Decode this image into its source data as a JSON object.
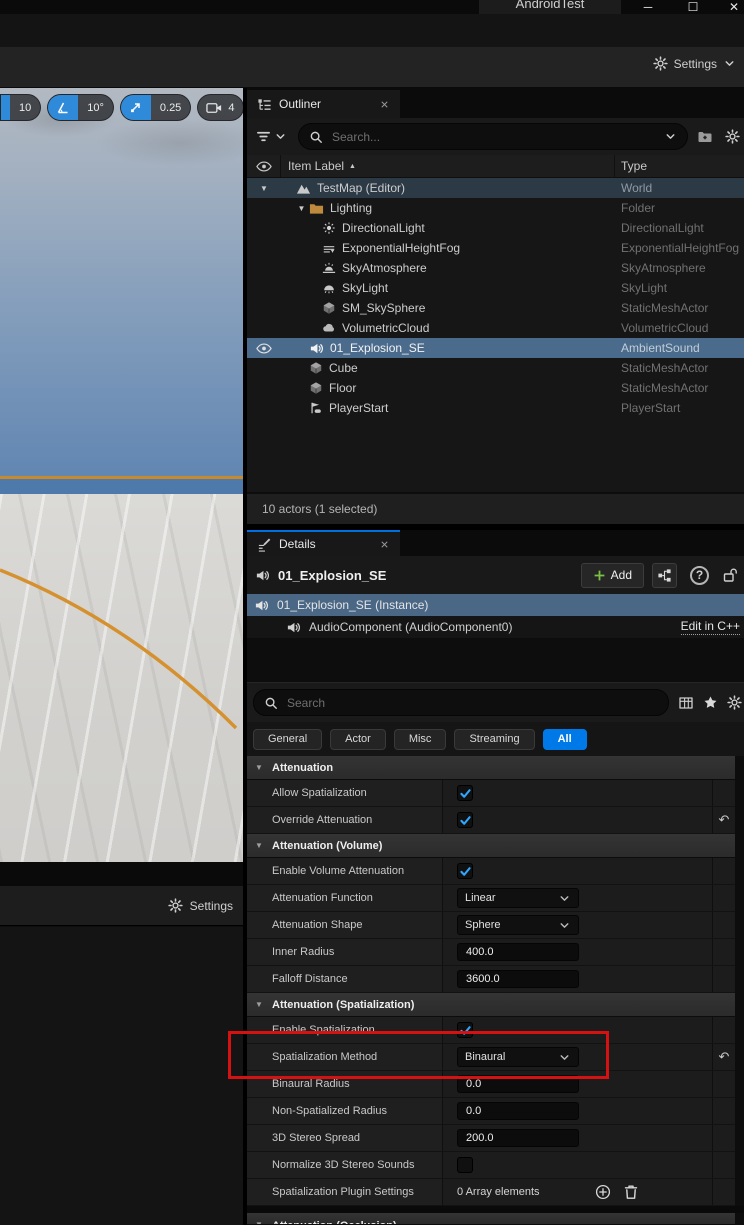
{
  "window": {
    "title": "AndroidTest",
    "controls": {
      "minimize": "─",
      "maximize": "☐",
      "close": "✕"
    }
  },
  "top_toolbar": {
    "settings_label": "Settings"
  },
  "viewport": {
    "snap_position": "10",
    "snap_rotation": "10°",
    "snap_scale": "0.25",
    "camera_speed": "4",
    "settings_label": "Settings"
  },
  "colors": {
    "selection_blue": "#4a6b8c",
    "accent_blue": "#0079e8",
    "check_blue": "#2fa7ff",
    "folder_orange": "#c08a3e",
    "horizon_orange": "#c98a2e",
    "highlight_red": "#d51111"
  },
  "outliner": {
    "tab": "Outliner",
    "search_placeholder": "Search...",
    "columns": {
      "item_label": "Item Label",
      "type": "Type"
    },
    "rows": [
      {
        "label": "TestMap (Editor)",
        "type": "World",
        "indent": 0,
        "icon": "world",
        "expander": true,
        "focus": true
      },
      {
        "label": "Lighting",
        "type": "Folder",
        "indent": 1,
        "icon": "folder",
        "expander": true
      },
      {
        "label": "DirectionalLight",
        "type": "DirectionalLight",
        "indent": 2,
        "icon": "sun"
      },
      {
        "label": "ExponentialHeightFog",
        "type": "ExponentialHeightFog",
        "indent": 2,
        "icon": "fog"
      },
      {
        "label": "SkyAtmosphere",
        "type": "SkyAtmosphere",
        "indent": 2,
        "icon": "atmosphere"
      },
      {
        "label": "SkyLight",
        "type": "SkyLight",
        "indent": 2,
        "icon": "skylight"
      },
      {
        "label": "SM_SkySphere",
        "type": "StaticMeshActor",
        "indent": 2,
        "icon": "mesh"
      },
      {
        "label": "VolumetricCloud",
        "type": "VolumetricCloud",
        "indent": 2,
        "icon": "cloud"
      },
      {
        "label": "01_Explosion_SE",
        "type": "AmbientSound",
        "indent": 1,
        "icon": "speaker",
        "selected": true
      },
      {
        "label": "Cube",
        "type": "StaticMeshActor",
        "indent": 1,
        "icon": "mesh"
      },
      {
        "label": "Floor",
        "type": "StaticMeshActor",
        "indent": 1,
        "icon": "mesh"
      },
      {
        "label": "PlayerStart",
        "type": "PlayerStart",
        "indent": 1,
        "icon": "player"
      }
    ],
    "status": "10 actors (1 selected)"
  },
  "details": {
    "tab": "Details",
    "actor_name": "01_Explosion_SE",
    "add_label": "Add",
    "instance_row": "01_Explosion_SE (Instance)",
    "component_row": "AudioComponent (AudioComponent0)",
    "edit_link": "Edit in C++",
    "search_placeholder": "Search",
    "filters": [
      "General",
      "Actor",
      "Misc",
      "Streaming",
      "All"
    ],
    "active_filter": "All",
    "sections": [
      {
        "title": "Attenuation",
        "rows": [
          {
            "label": "Allow Spatialization",
            "control": "checkbox",
            "value": true
          },
          {
            "label": "Override Attenuation",
            "control": "checkbox",
            "value": true,
            "reset": true
          }
        ]
      },
      {
        "title": "Attenuation (Volume)",
        "rows": [
          {
            "label": "Enable Volume Attenuation",
            "control": "checkbox",
            "value": true
          },
          {
            "label": "Attenuation Function",
            "control": "dropdown",
            "value": "Linear"
          },
          {
            "label": "Attenuation Shape",
            "control": "dropdown",
            "value": "Sphere"
          },
          {
            "label": "Inner Radius",
            "control": "number",
            "value": "400.0"
          },
          {
            "label": "Falloff Distance",
            "control": "number",
            "value": "3600.0"
          }
        ]
      },
      {
        "title": "Attenuation (Spatialization)",
        "rows": [
          {
            "label": "Enable Spatialization",
            "control": "checkbox",
            "value": true
          },
          {
            "label": "Spatialization Method",
            "control": "dropdown",
            "value": "Binaural",
            "reset": true
          },
          {
            "label": "Binaural Radius",
            "control": "number",
            "value": "0.0"
          },
          {
            "label": "Non-Spatialized Radius",
            "control": "number",
            "value": "0.0"
          },
          {
            "label": "3D Stereo Spread",
            "control": "number",
            "value": "200.0"
          },
          {
            "label": "Normalize 3D Stereo Sounds",
            "control": "checkbox",
            "value": false
          },
          {
            "label": "Spatialization Plugin Settings",
            "control": "array",
            "value": "0 Array elements"
          }
        ]
      },
      {
        "title": "Attenuation (Occlusion)",
        "partial": true,
        "rows": []
      }
    ]
  }
}
